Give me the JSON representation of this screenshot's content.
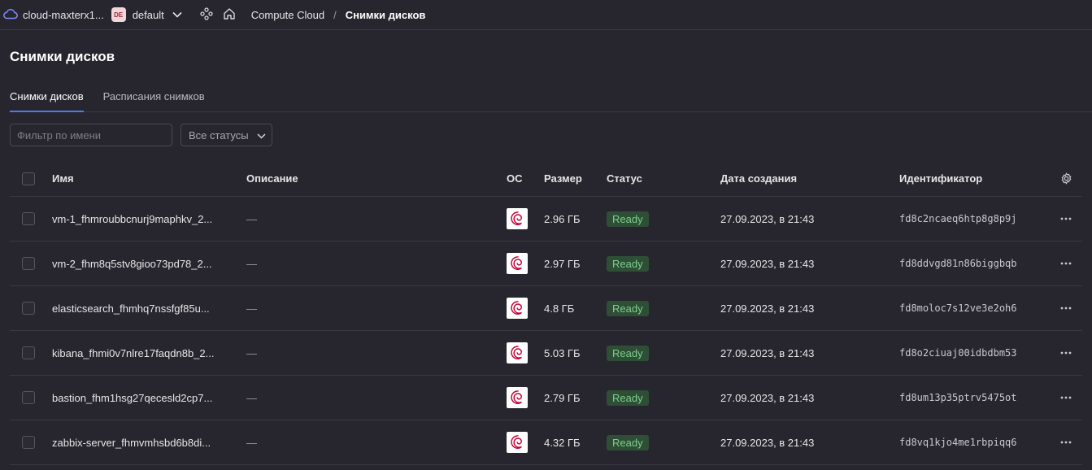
{
  "header": {
    "cloud_name": "cloud-maxterx1...",
    "folder_badge": "DE",
    "folder_name": "default",
    "breadcrumb_service": "Compute Cloud",
    "breadcrumb_separator": "/",
    "breadcrumb_current": "Снимки дисков"
  },
  "page": {
    "title": "Снимки дисков",
    "tabs": [
      {
        "label": "Снимки дисков",
        "active": true
      },
      {
        "label": "Расписания снимков",
        "active": false
      }
    ]
  },
  "filters": {
    "name_placeholder": "Фильтр по имени",
    "status_value": "Все статусы"
  },
  "table": {
    "headers": {
      "name": "Имя",
      "description": "Описание",
      "os": "ОС",
      "size": "Размер",
      "status": "Статус",
      "created": "Дата создания",
      "id": "Идентификатор"
    },
    "rows": [
      {
        "name": "vm-1_fhmroubbcnurj9maphkv_2...",
        "description": "—",
        "size": "2.96 ГБ",
        "status": "Ready",
        "created": "27.09.2023, в 21:43",
        "id": "fd8c2ncaeq6htp8g8p9j"
      },
      {
        "name": "vm-2_fhm8q5stv8gioo73pd78_2...",
        "description": "—",
        "size": "2.97 ГБ",
        "status": "Ready",
        "created": "27.09.2023, в 21:43",
        "id": "fd8ddvgd81n86biggbqb"
      },
      {
        "name": "elasticsearch_fhmhq7nssfgf85u...",
        "description": "—",
        "size": "4.8 ГБ",
        "status": "Ready",
        "created": "27.09.2023, в 21:43",
        "id": "fd8moloc7s12ve3e2oh6"
      },
      {
        "name": "kibana_fhmi0v7nlre17faqdn8b_2...",
        "description": "—",
        "size": "5.03 ГБ",
        "status": "Ready",
        "created": "27.09.2023, в 21:43",
        "id": "fd8o2ciuaj00idbdbm53"
      },
      {
        "name": "bastion_fhm1hsg27qecesld2cp7...",
        "description": "—",
        "size": "2.79 ГБ",
        "status": "Ready",
        "created": "27.09.2023, в 21:43",
        "id": "fd8um13p35ptrv5475ot"
      },
      {
        "name": "zabbix-server_fhmvmhsbd6b8di...",
        "description": "—",
        "size": "4.32 ГБ",
        "status": "Ready",
        "created": "27.09.2023, в 21:43",
        "id": "fd8vq1kjo4me1rbpiqq6"
      }
    ]
  },
  "icons": {
    "cloud": "cloud-icon",
    "chevron": "chevron-down-icon",
    "services": "services-icon",
    "home": "home-icon",
    "os": "debian-logo-icon",
    "settings": "gear-icon",
    "row_menu": "more-horizontal-icon"
  },
  "colors": {
    "background": "#27262e",
    "ready_bg": "#2e4e36",
    "ready_text": "#7fce8d",
    "tab_accent": "#4a7cf0",
    "debian_red": "#c70036"
  }
}
